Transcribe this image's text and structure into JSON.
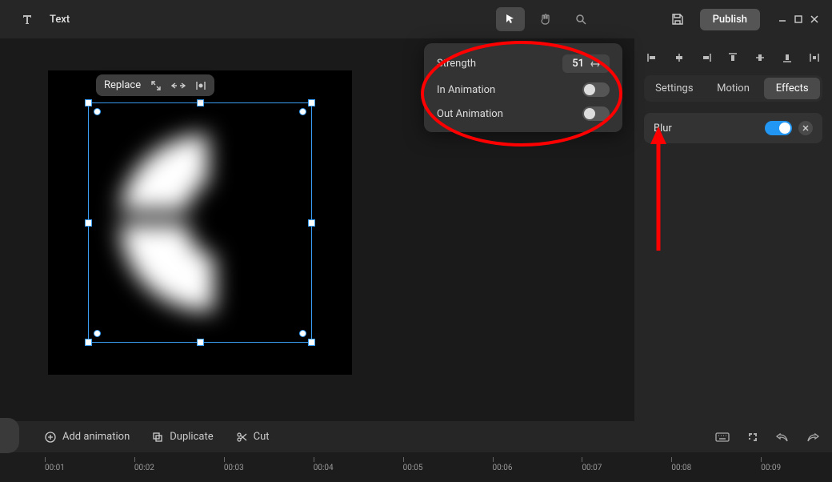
{
  "topbar": {
    "tool_label": "Text",
    "publish_label": "Publish"
  },
  "float_toolbar": {
    "replace_label": "Replace"
  },
  "popover": {
    "strength_label": "Strength",
    "strength_value": "51",
    "in_anim_label": "In Animation",
    "out_anim_label": "Out Animation",
    "in_anim_on": false,
    "out_anim_on": false
  },
  "rightpanel": {
    "tabs": {
      "settings": "Settings",
      "motion": "Motion",
      "effects": "Effects"
    },
    "active_tab": "effects",
    "effect_label": "Blur",
    "effect_on": true
  },
  "footer": {
    "add_animation": "Add animation",
    "duplicate": "Duplicate",
    "cut": "Cut"
  },
  "timeline": {
    "ticks": [
      "00:01",
      "00:02",
      "00:03",
      "00:04",
      "00:05",
      "00:06",
      "00:07",
      "00:08",
      "00:09"
    ]
  },
  "annotation": {
    "ellipse_color": "#ff0000",
    "arrow_color": "#ff0000"
  }
}
